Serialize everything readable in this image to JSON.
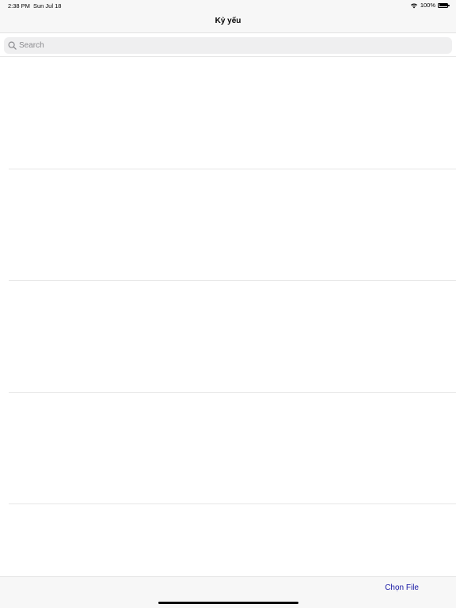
{
  "status_bar": {
    "time": "2:38 PM",
    "date": "Sun Jul 18",
    "battery": "100%",
    "battery_level": 1.0,
    "wifi_icon": "wifi-icon",
    "battery_icon": "battery-icon"
  },
  "nav": {
    "title": "Kỷ yếu"
  },
  "search": {
    "placeholder": "Search",
    "value": "",
    "icon": "search-icon"
  },
  "list": {
    "rows": [
      "",
      "",
      "",
      "",
      ""
    ]
  },
  "toolbar": {
    "choose_file_label": "Chọn File",
    "accent_color": "#1a1aa6"
  }
}
